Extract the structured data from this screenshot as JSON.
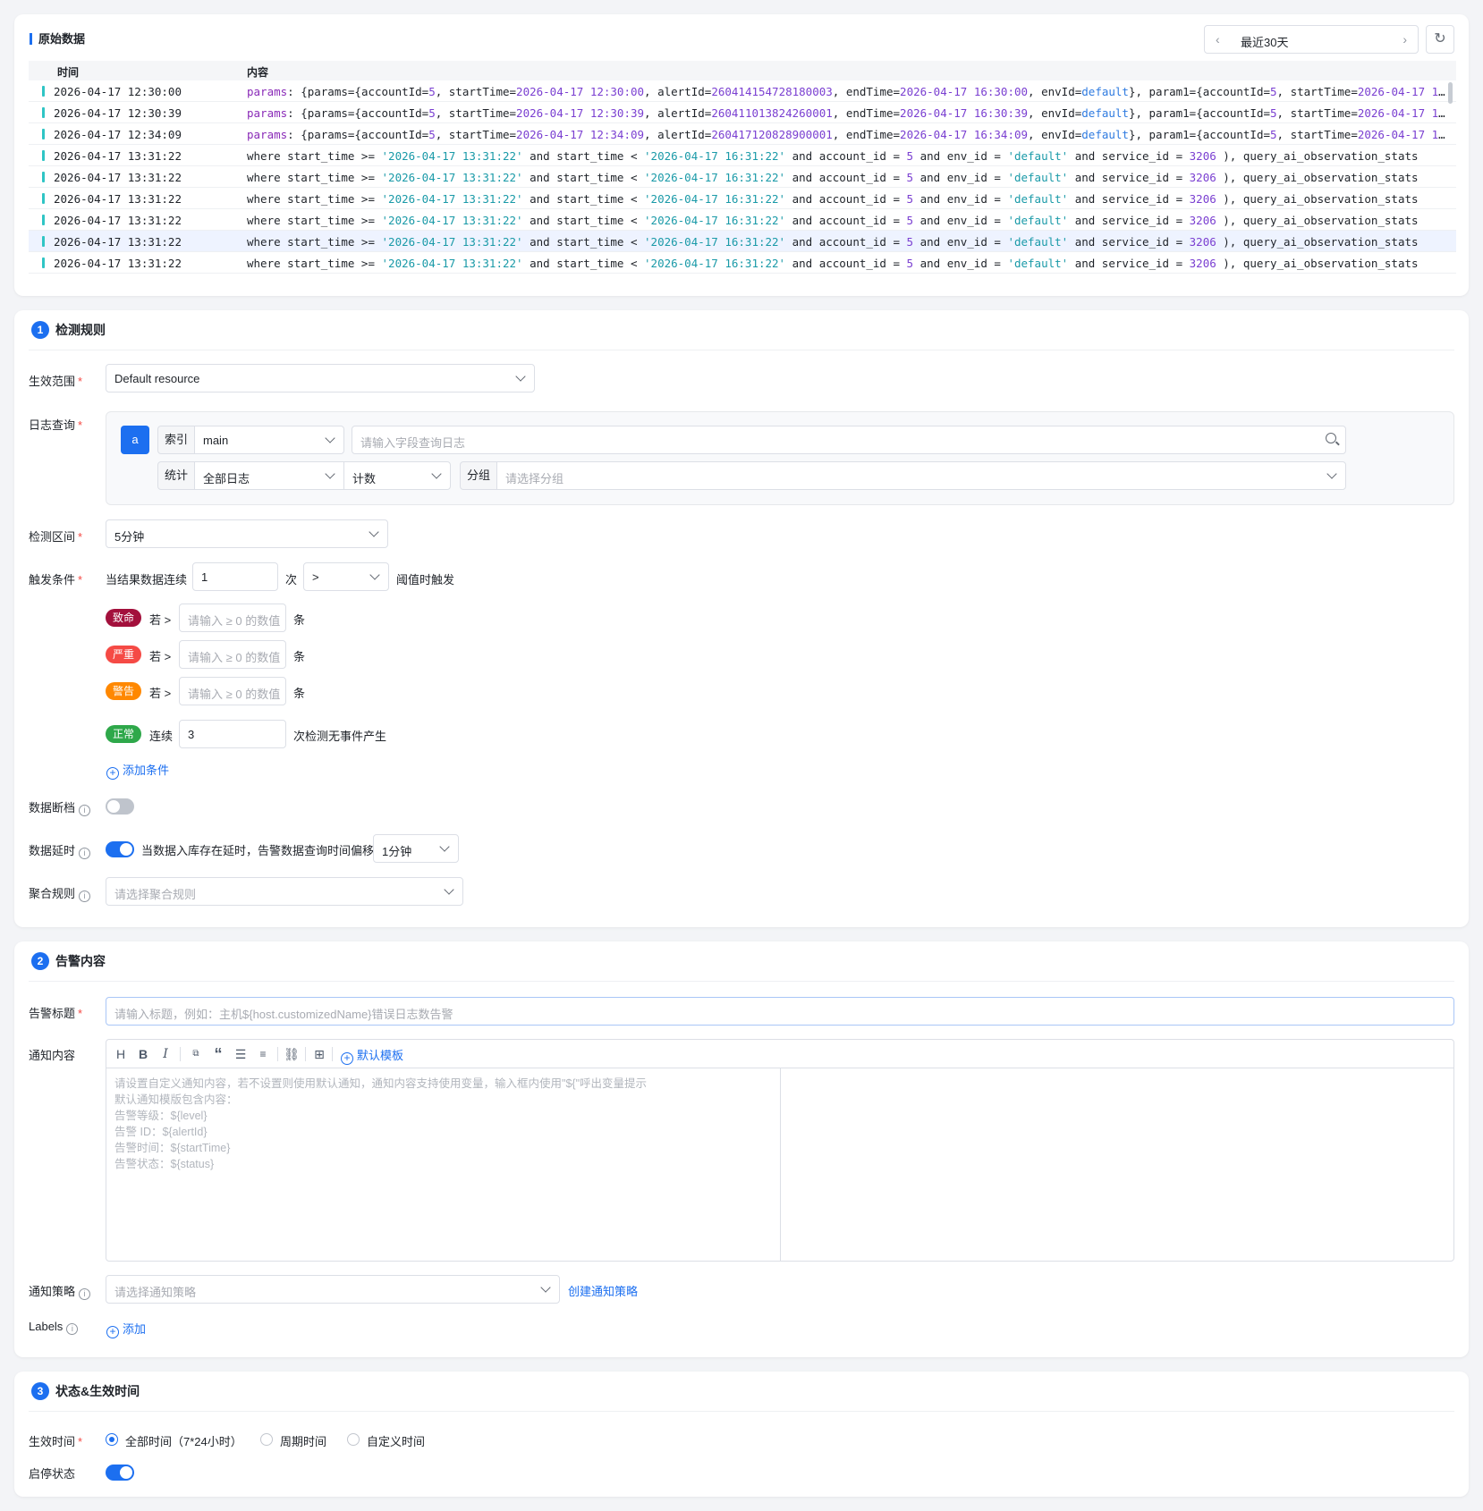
{
  "raw": {
    "title": "原始数据",
    "range_label": "最近30天",
    "col_time": "时间",
    "col_content": "内容",
    "rows": [
      {
        "time": "2026-04-17 12:30:00",
        "type": "params",
        "start": "12:30:00",
        "alert": "260414154728180003",
        "end": "16:30:00"
      },
      {
        "time": "2026-04-17 12:30:39",
        "type": "params",
        "start": "12:30:39",
        "alert": "260411013824260001",
        "end": "16:30:39"
      },
      {
        "time": "2026-04-17 12:34:09",
        "type": "params",
        "start": "12:34:09",
        "alert": "260417120828900001",
        "end": "16:34:09"
      },
      {
        "time": "2026-04-17 13:31:22",
        "type": "where"
      },
      {
        "time": "2026-04-17 13:31:22",
        "type": "where"
      },
      {
        "time": "2026-04-17 13:31:22",
        "type": "where"
      },
      {
        "time": "2026-04-17 13:31:22",
        "type": "where"
      },
      {
        "time": "2026-04-17 13:31:22",
        "type": "where"
      },
      {
        "time": "2026-04-17 13:31:22",
        "type": "where"
      }
    ]
  },
  "rule": {
    "num": "1",
    "title": "检测规则",
    "scope_label": "生效范围",
    "scope_value": "Default resource",
    "log_label": "日志查询",
    "query_letter": "a",
    "index_addon": "索引",
    "index_value": "main",
    "query_placeholder": "请输入字段查询日志",
    "stat_addon": "统计",
    "stat_value": "全部日志",
    "count_value": "计数",
    "group_addon": "分组",
    "group_placeholder": "请选择分组",
    "interval_label": "检测区间",
    "interval_value": "5分钟",
    "trigger_label": "触发条件",
    "trigger_prefix": "当结果数据连续",
    "trigger_count": "1",
    "trigger_times": "次",
    "trigger_op": ">",
    "trigger_suffix": "阈值时触发",
    "levels": [
      {
        "tag": "致命",
        "color": "#a3103c",
        "if": "若 >",
        "placeholder": "请输入 ≥ 0 的数值",
        "unit": "条"
      },
      {
        "tag": "严重",
        "color": "#f54a45",
        "if": "若 >",
        "placeholder": "请输入 ≥ 0 的数值",
        "unit": "条"
      },
      {
        "tag": "警告",
        "color": "#ff8800",
        "if": "若 >",
        "placeholder": "请输入 ≥ 0 的数值",
        "unit": "条"
      }
    ],
    "normal_tag": "正常",
    "normal_color": "#2ea84a",
    "normal_prefix": "连续",
    "normal_value": "3",
    "normal_suffix": "次检测无事件产生",
    "add_condition": "添加条件",
    "gap_label": "数据断档",
    "delay_label": "数据延时",
    "delay_text": "当数据入库存在延时，告警数据查询时间偏移",
    "delay_value": "1分钟",
    "agg_label": "聚合规则",
    "agg_placeholder": "请选择聚合规则"
  },
  "alert": {
    "num": "2",
    "title": "告警内容",
    "title_label": "告警标题",
    "title_placeholder": "请输入标题，例如：主机${host.customizedName}错误日志数告警",
    "notify_label": "通知内容",
    "template_link": "默认模板",
    "editor_lines": [
      "请设置自定义通知内容，若不设置则使用默认通知，通知内容支持使用变量，输入框内使用\"${\"呼出变量提示",
      "默认通知模版包含内容：",
      "告警等级：${level}",
      "告警 ID：${alertId}",
      "告警时间：${startTime}",
      "告警状态：${status}"
    ],
    "policy_label": "通知策略",
    "policy_placeholder": "请选择通知策略",
    "create_policy": "创建通知策略",
    "labels_label": "Labels",
    "add_label": "添加"
  },
  "status": {
    "num": "3",
    "title": "状态&生效时间",
    "time_label": "生效时间",
    "opt_all": "全部时间（7*24小时）",
    "opt_period": "周期时间",
    "opt_custom": "自定义时间",
    "enable_label": "启停状态"
  }
}
